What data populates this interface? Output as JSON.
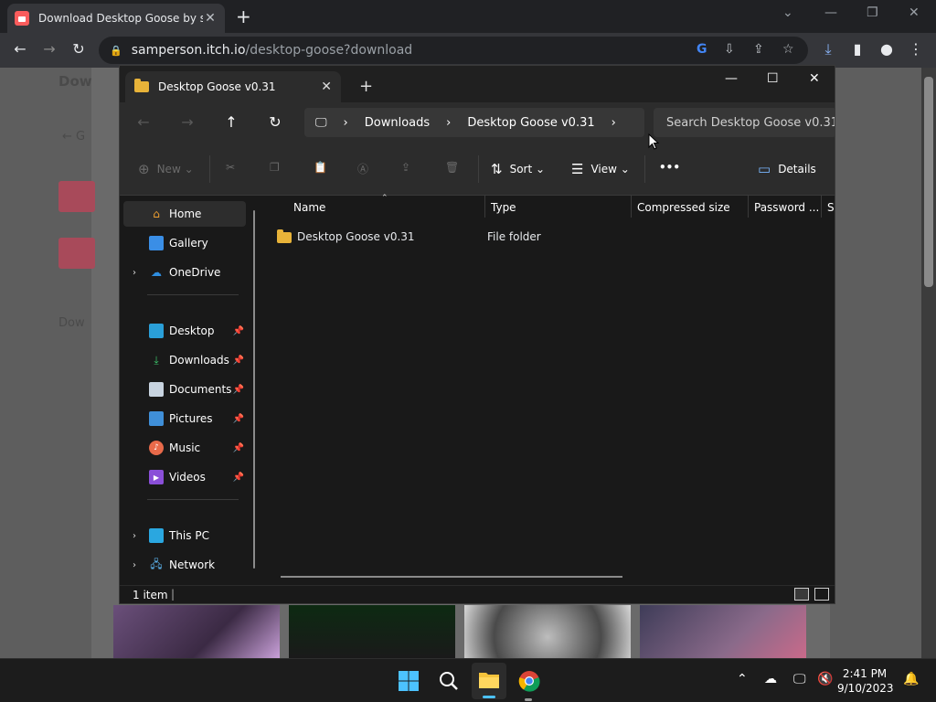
{
  "browser": {
    "tab_title": "Download Desktop Goose by sar",
    "url_host": "samperson.itch.io",
    "url_path": "/desktop-goose?download"
  },
  "explorer": {
    "tab_title": "Desktop Goose v0.31",
    "breadcrumbs": [
      "Downloads",
      "Desktop Goose v0.31"
    ],
    "search_placeholder": "Search Desktop Goose v0.31",
    "commands": {
      "new": "New",
      "sort": "Sort",
      "view": "View",
      "more": "•••",
      "details": "Details"
    },
    "nav": {
      "home": "Home",
      "gallery": "Gallery",
      "onedrive": "OneDrive",
      "desktop": "Desktop",
      "downloads": "Downloads",
      "documents": "Documents",
      "pictures": "Pictures",
      "music": "Music",
      "videos": "Videos",
      "thispc": "This PC",
      "network": "Network"
    },
    "columns": [
      "Name",
      "Type",
      "Compressed size",
      "Password ...",
      "Si"
    ],
    "files": [
      {
        "name": "Desktop Goose v0.31",
        "type": "File folder"
      }
    ],
    "status": "1 item"
  },
  "taskbar": {
    "time": "2:41 PM",
    "date": "9/10/2023"
  }
}
